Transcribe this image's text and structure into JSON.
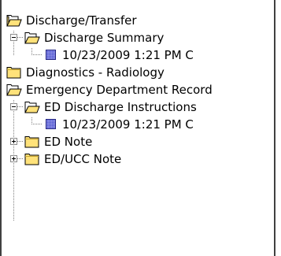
{
  "tree": {
    "items": [
      {
        "label": "Discharge/Transfer",
        "icon": "open-folder-icon",
        "level": 0,
        "expanded": true
      },
      {
        "label": "Discharge Summary",
        "icon": "open-folder-icon",
        "level": 1,
        "expanded": true
      },
      {
        "label": "10/23/2009 1:21 PM  C",
        "icon": "document-icon",
        "level": 2
      },
      {
        "label": "Diagnostics - Radiology",
        "icon": "closed-folder-icon",
        "level": 0,
        "expanded": false
      },
      {
        "label": "Emergency Department Record",
        "icon": "open-folder-icon",
        "level": 0,
        "expanded": true
      },
      {
        "label": "ED Discharge Instructions",
        "icon": "open-folder-icon",
        "level": 1,
        "expanded": true
      },
      {
        "label": "10/23/2009 1:21 PM  C",
        "icon": "document-icon",
        "level": 2
      },
      {
        "label": "ED Note",
        "icon": "closed-folder-icon",
        "level": 1,
        "expanded": false
      },
      {
        "label": "ED/UCC Note",
        "icon": "closed-folder-icon",
        "level": 1,
        "expanded": false
      }
    ]
  },
  "colors": {
    "folder_fill": "#ffe27a",
    "folder_outline": "#000000",
    "document": "#4a4fd1",
    "tree_lines": "#808080"
  }
}
